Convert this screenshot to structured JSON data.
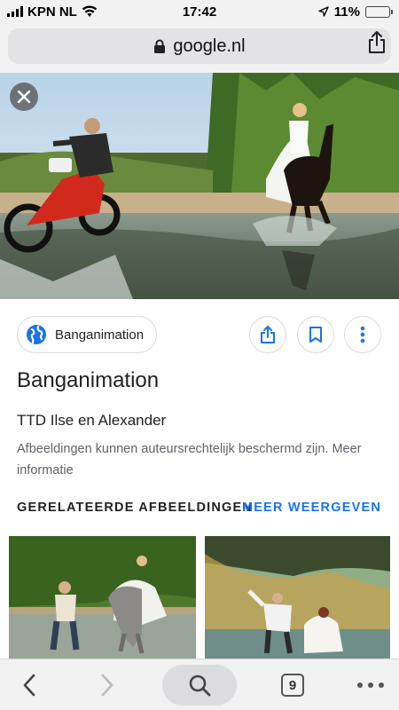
{
  "status_bar": {
    "carrier": "KPN NL",
    "time": "17:42",
    "battery_percent": "11%",
    "battery_level": 0.11,
    "icons": [
      "signal-icon",
      "wifi-icon",
      "location-arrow-icon",
      "battery-icon"
    ]
  },
  "browser": {
    "url": "google.nl",
    "icons": [
      "lock-icon",
      "share-icon"
    ]
  },
  "image_viewer": {
    "close_icon": "close-icon",
    "source_name": "Banganimation",
    "source_icon": "globe-icon",
    "action_icons": [
      "share-icon",
      "bookmark-icon",
      "more-vert-icon"
    ],
    "title": "Banganimation",
    "subtitle": "TTD Ilse en Alexander",
    "copyright_notice": "Afbeeldingen kunnen auteursrechtelijk beschermd zijn. Meer informatie"
  },
  "related": {
    "heading": "GERELATEERDE AFBEELDINGEN",
    "more_label": "MEER WEERGEVEN"
  },
  "toolbar": {
    "tab_count": "9",
    "icons": [
      "back-icon",
      "forward-icon",
      "search-icon",
      "tabs-icon",
      "more-horiz-icon"
    ]
  },
  "colors": {
    "accent": "#1a73e8",
    "battery_low": "#e02020",
    "chrome_bg": "#f2f2f2"
  }
}
